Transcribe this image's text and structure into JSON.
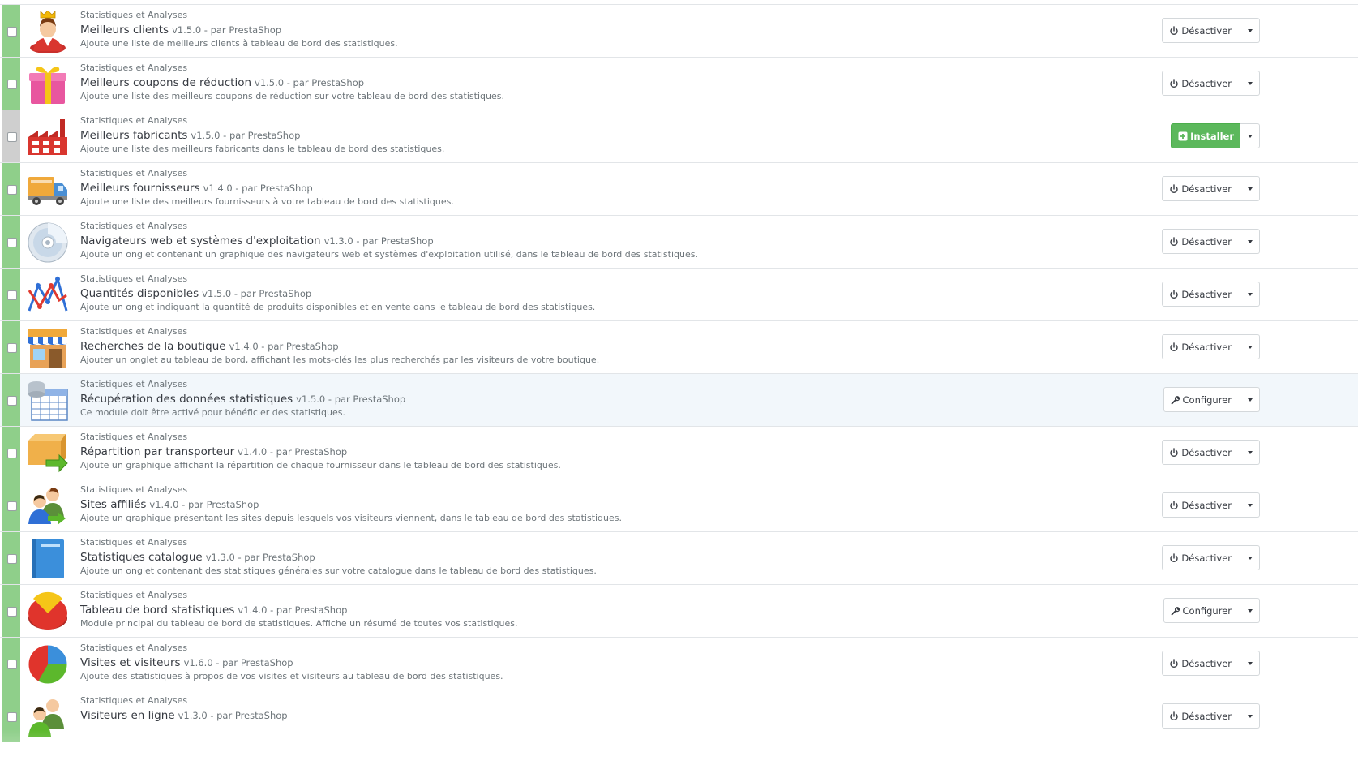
{
  "modules": [
    {
      "category": "Statistiques et Analyses",
      "name": "Meilleurs clients",
      "version": "v1.5.0 - par PrestaShop",
      "description": "Ajoute une liste de meilleurs clients à tableau de bord des statistiques.",
      "icon": "customer-crown-icon",
      "enabled": true,
      "action": "Désactiver",
      "action_icon": "power-icon"
    },
    {
      "category": "Statistiques et Analyses",
      "name": "Meilleurs coupons de réduction",
      "version": "v1.5.0 - par PrestaShop",
      "description": "Ajoute une liste des meilleurs coupons de réduction sur votre tableau de bord des statistiques.",
      "icon": "gift-icon",
      "enabled": true,
      "action": "Désactiver",
      "action_icon": "power-icon"
    },
    {
      "category": "Statistiques et Analyses",
      "name": "Meilleurs fabricants",
      "version": "v1.5.0 - par PrestaShop",
      "description": "Ajoute une liste des meilleurs fabricants dans le tableau de bord des statistiques.",
      "icon": "factory-icon",
      "enabled": false,
      "action": "Installer",
      "action_icon": "plus-square-icon"
    },
    {
      "category": "Statistiques et Analyses",
      "name": "Meilleurs fournisseurs",
      "version": "v1.4.0 - par PrestaShop",
      "description": "Ajoute une liste des meilleurs fournisseurs à votre tableau de bord des statistiques.",
      "icon": "truck-icon",
      "enabled": true,
      "action": "Désactiver",
      "action_icon": "power-icon"
    },
    {
      "category": "Statistiques et Analyses",
      "name": "Navigateurs web et systèmes d'exploitation",
      "version": "v1.3.0 - par PrestaShop",
      "description": "Ajoute un onglet contenant un graphique des navigateurs web et systèmes d'exploitation utilisé, dans le tableau de bord des statistiques.",
      "icon": "cd-icon",
      "enabled": true,
      "action": "Désactiver",
      "action_icon": "power-icon"
    },
    {
      "category": "Statistiques et Analyses",
      "name": "Quantités disponibles",
      "version": "v1.5.0 - par PrestaShop",
      "description": "Ajoute un onglet indiquant la quantité de produits disponibles et en vente dans le tableau de bord des statistiques.",
      "icon": "line-chart-icon",
      "enabled": true,
      "action": "Désactiver",
      "action_icon": "power-icon"
    },
    {
      "category": "Statistiques et Analyses",
      "name": "Recherches de la boutique",
      "version": "v1.4.0 - par PrestaShop",
      "description": "Ajouter un onglet au tableau de bord, affichant les mots-clés les plus recherchés par les visiteurs de votre boutique.",
      "icon": "shop-icon",
      "enabled": true,
      "action": "Désactiver",
      "action_icon": "power-icon"
    },
    {
      "category": "Statistiques et Analyses",
      "name": "Récupération des données statistiques",
      "version": "v1.5.0 - par PrestaShop",
      "description": "Ce module doit être activé pour bénéficier des statistiques.",
      "icon": "database-table-icon",
      "enabled": true,
      "action": "Configurer",
      "action_icon": "wrench-icon",
      "highlight": true
    },
    {
      "category": "Statistiques et Analyses",
      "name": "Répartition par transporteur",
      "version": "v1.4.0 - par PrestaShop",
      "description": "Ajoute un graphique affichant la répartition de chaque fournisseur dans le tableau de bord des statistiques.",
      "icon": "box-arrow-icon",
      "enabled": true,
      "action": "Désactiver",
      "action_icon": "power-icon"
    },
    {
      "category": "Statistiques et Analyses",
      "name": "Sites affiliés",
      "version": "v1.4.0 - par PrestaShop",
      "description": "Ajoute un graphique présentant les sites depuis lesquels vos visiteurs viennent, dans le tableau de bord des statistiques.",
      "icon": "users-arrow-icon",
      "enabled": true,
      "action": "Désactiver",
      "action_icon": "power-icon"
    },
    {
      "category": "Statistiques et Analyses",
      "name": "Statistiques catalogue",
      "version": "v1.3.0 - par PrestaShop",
      "description": "Ajoute un onglet contenant des statistiques générales sur votre catalogue dans le tableau de bord des statistiques.",
      "icon": "book-icon",
      "enabled": true,
      "action": "Désactiver",
      "action_icon": "power-icon"
    },
    {
      "category": "Statistiques et Analyses",
      "name": "Tableau de bord statistiques",
      "version": "v1.4.0 - par PrestaShop",
      "description": "Module principal du tableau de bord de statistiques. Affiche un résumé de toutes vos statistiques.",
      "icon": "pie-chart-red-icon",
      "enabled": true,
      "action": "Configurer",
      "action_icon": "wrench-icon"
    },
    {
      "category": "Statistiques et Analyses",
      "name": "Visites et visiteurs",
      "version": "v1.6.0 - par PrestaShop",
      "description": "Ajoute des statistiques à propos de vos visites et visiteurs au tableau de bord des statistiques.",
      "icon": "pie-chart-color-icon",
      "enabled": true,
      "action": "Désactiver",
      "action_icon": "power-icon"
    },
    {
      "category": "Statistiques et Analyses",
      "name": "Visiteurs en ligne",
      "version": "v1.3.0 - par PrestaShop",
      "description": "",
      "icon": "users-online-icon",
      "enabled": true,
      "action": "Désactiver",
      "action_icon": "power-icon"
    }
  ],
  "colors": {
    "enabled": "#8fcf8a",
    "disabled": "#cfcfcf",
    "install": "#5cb85c",
    "text": "#363a41",
    "muted": "#6c7479"
  }
}
